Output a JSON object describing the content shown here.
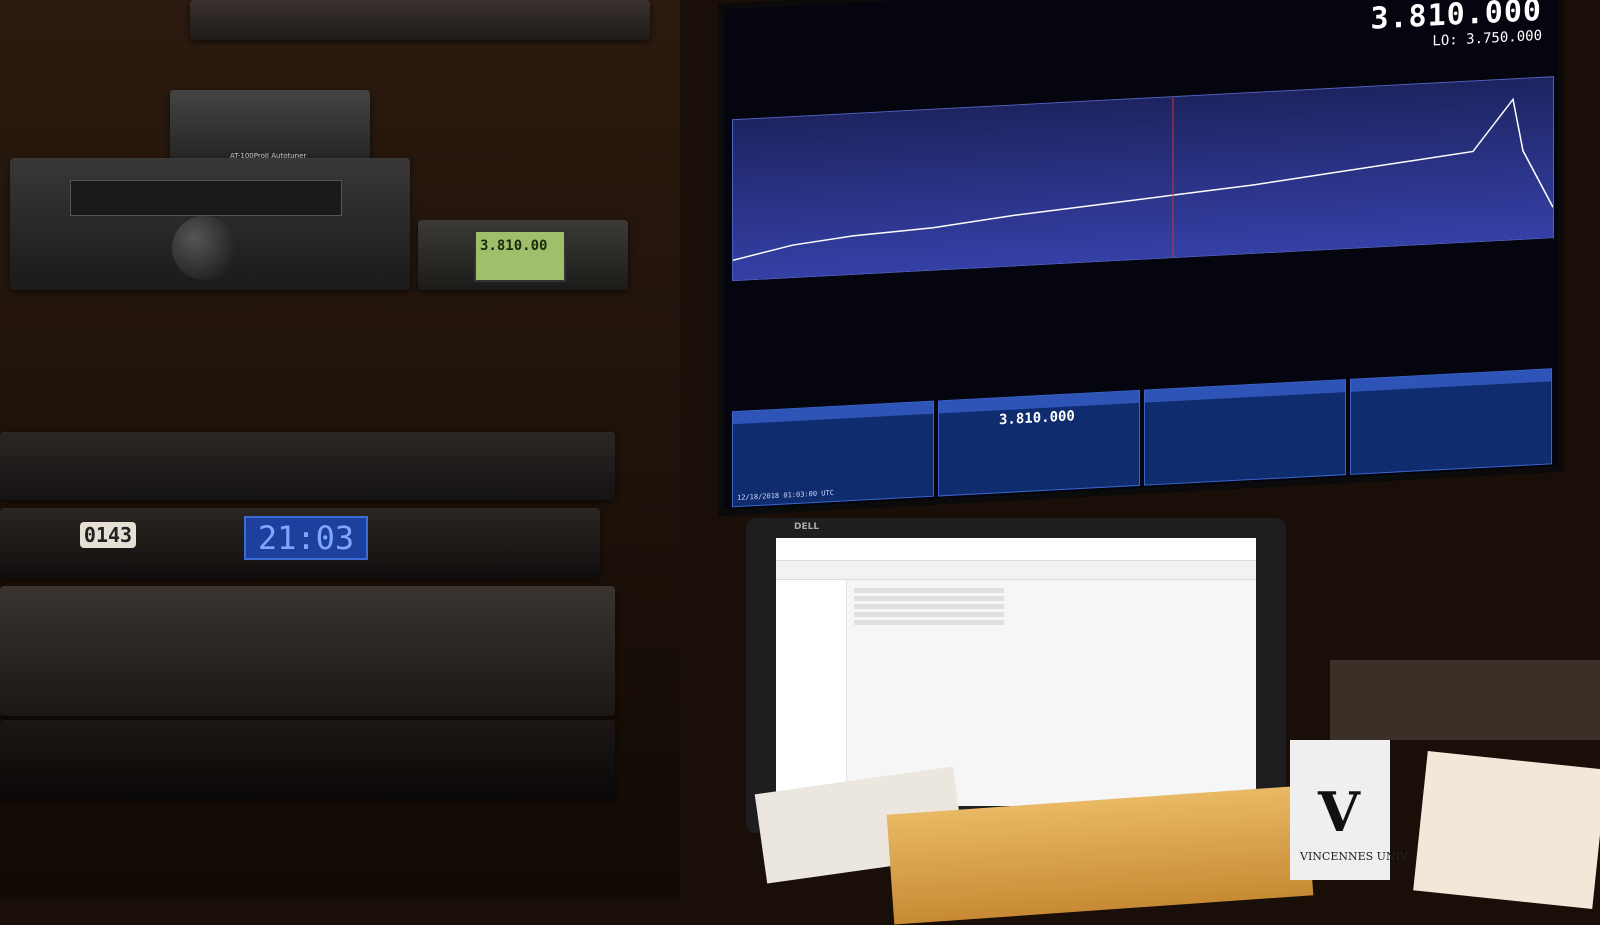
{
  "image": {
    "alt": "Amateur radio station with equipment rack, SDR software on a large monitor, and a laptop showing a file explorer"
  },
  "rack": {
    "tuner_label": "AT-100ProII Autotuner",
    "mobile_display": "3.810.00",
    "counter_display": "0143",
    "clock_display": "21:03"
  },
  "monitor": {
    "frequency": "3.810.000",
    "lo_label": "LO:",
    "lo_value": "3.750.000",
    "panel_frequency": "3.810.000",
    "timestamp": "12/18/2018 01:03:00 UTC"
  },
  "laptop": {
    "brand": "DELL"
  },
  "desk": {
    "cube_letter": "V",
    "cube_text": "VINCENNES UNIV"
  }
}
